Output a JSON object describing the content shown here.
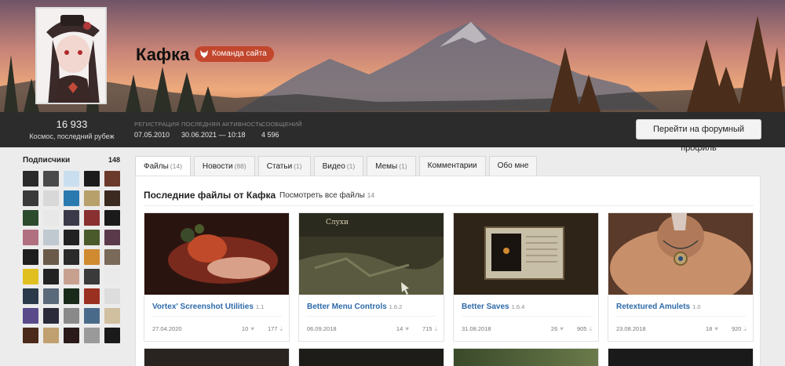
{
  "profile": {
    "username": "Кафка",
    "badge": "Команда сайта",
    "reputation": "16 933",
    "rank": "Космос, последний рубеж"
  },
  "stats": [
    {
      "label": "Регистрация",
      "value": "07.05.2010"
    },
    {
      "label": "Последняя активность",
      "value": "30.06.2021 — 10:18"
    },
    {
      "label": "Сообщений",
      "value": "4 596"
    }
  ],
  "forum_button": "Перейти на форумный профиль",
  "subscribers": {
    "title": "Подписчики",
    "count": "148"
  },
  "tabs": [
    {
      "label": "Файлы",
      "count": "(14)"
    },
    {
      "label": "Новости",
      "count": "(88)"
    },
    {
      "label": "Статьи",
      "count": "(1)"
    },
    {
      "label": "Видео",
      "count": "(1)"
    },
    {
      "label": "Мемы",
      "count": "(1)"
    },
    {
      "label": "Комментарии",
      "count": ""
    },
    {
      "label": "Обо мне",
      "count": ""
    }
  ],
  "files_section": {
    "title": "Последние файлы от Кафка",
    "see_all": "Посмотреть все файлы",
    "see_all_count": "14"
  },
  "files": [
    {
      "title": "Vortex' Screenshot Utilities",
      "version": "1.1",
      "date": "27.04.2020",
      "likes": "10",
      "downloads": "177"
    },
    {
      "title": "Better Menu Controls",
      "version": "1.6.2",
      "date": "06.09.2018",
      "likes": "14",
      "downloads": "715"
    },
    {
      "title": "Better Saves",
      "version": "1.6.4",
      "date": "31.08.2018",
      "likes": "26",
      "downloads": "905"
    },
    {
      "title": "Retextured Amulets",
      "version": "1.0",
      "date": "23.08.2018",
      "likes": "18",
      "downloads": "920"
    }
  ],
  "thumb_text": {
    "rumors": "Слухи"
  },
  "colors": {
    "badge": "#c2472d",
    "link": "#2d6aa8",
    "statsbar": "#2c2c2c",
    "background": "#ececec"
  }
}
